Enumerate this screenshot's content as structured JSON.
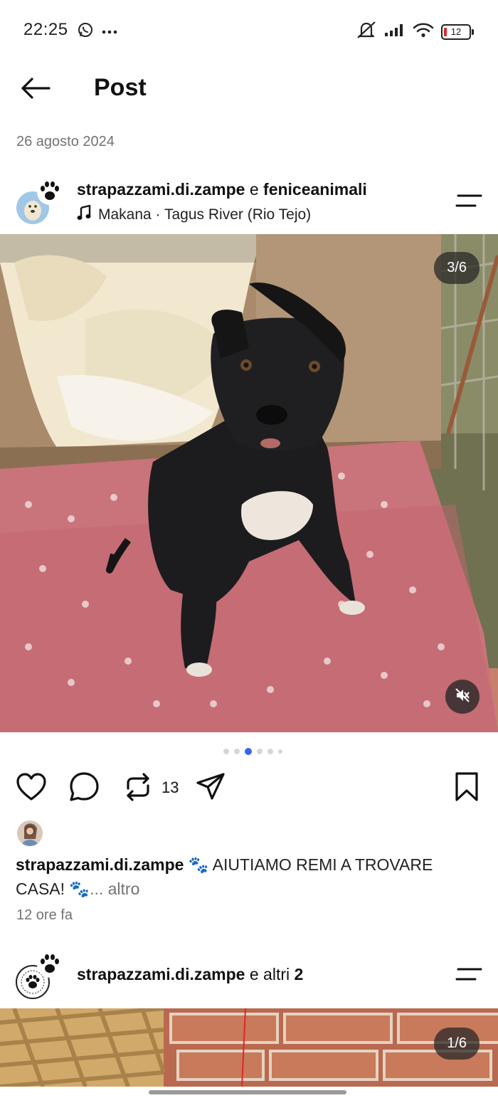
{
  "status_bar": {
    "time": "22:25",
    "battery_level": "12",
    "battery_color": "#e0262a",
    "icons": [
      "whatsapp-icon",
      "more-dots-icon",
      "mute-icon",
      "signal-icon",
      "wifi-icon",
      "battery-icon"
    ]
  },
  "header": {
    "title": "Post",
    "back_icon": "arrow-left-icon"
  },
  "post": {
    "date": "26 agosto 2024",
    "author_primary": "strapazzami.di.zampe",
    "author_joiner": " e ",
    "author_secondary": "feniceanimali",
    "music": "Makana · Tagus River (Rio Tejo)",
    "media_counter": "3/6",
    "carousel": {
      "total": 6,
      "active": 3
    },
    "repost_count": "13",
    "caption_author": "strapazzami.di.zampe",
    "caption_text": " 🐾 AIUTIAMO REMI A TROVARE CASA! 🐾",
    "caption_more": "... altro",
    "time_ago": "12 ore fa"
  },
  "next_post": {
    "author_primary": "strapazzami.di.zampe",
    "author_joiner": " e altri ",
    "others_count": "2",
    "media_counter": "1/6"
  },
  "colors": {
    "accent_blue": "#3a64ec",
    "muted_text": "#737373"
  }
}
